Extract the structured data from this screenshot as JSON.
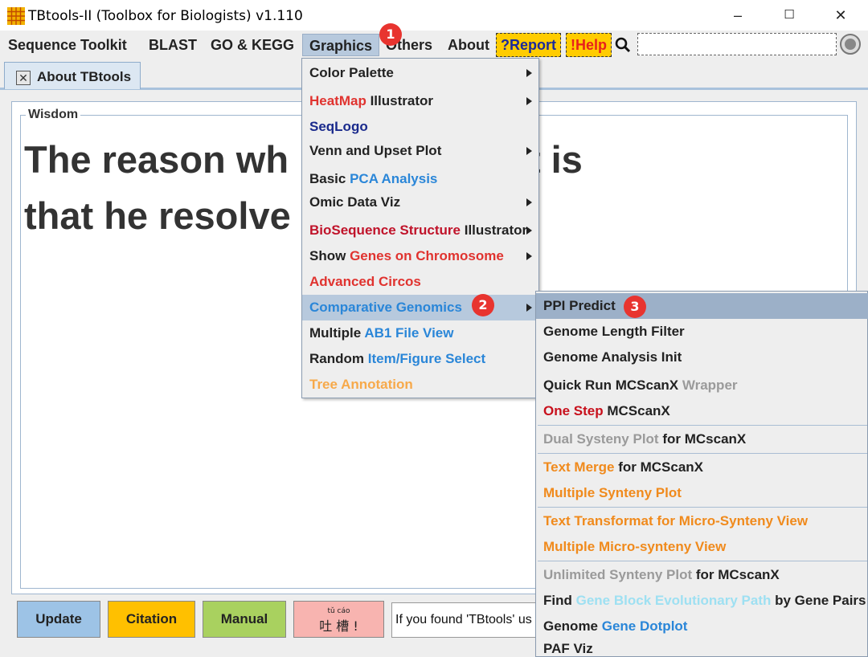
{
  "window": {
    "title": "TBtools-II (Toolbox for Biologists) v1.110",
    "minimize_label": "–",
    "maximize_label": "☐",
    "close_label": "✕"
  },
  "menubar": {
    "items": [
      "Sequence Toolkit",
      "BLAST",
      "GO & KEGG",
      "Graphics",
      "Others",
      "About"
    ],
    "report_label": "?Report",
    "help_label": "!Help",
    "search_placeholder": ""
  },
  "tab": {
    "label": "About TBtools",
    "close": "✕"
  },
  "wisdom": {
    "legend": "Wisdom",
    "line1": "The reason wh      an is great is",
    "line2": "that he resolve        at man."
  },
  "bottom": {
    "update": "Update",
    "citation": "Citation",
    "manual": "Manual",
    "tucao_pinyin": "tǔ   cáo",
    "tucao": "吐 槽 !",
    "notice": "If you found 'TBtools' us"
  },
  "graphics_menu": {
    "color_palette": "Color Palette",
    "heatmap_a": "HeatMap",
    "heatmap_b": " Illustrator",
    "seqlogo": "SeqLogo",
    "venn": "Venn and Upset Plot",
    "pca_a": "Basic ",
    "pca_b": "PCA Analysis",
    "omic": "Omic Data Viz",
    "bioseq_a": "BioSequence Structure",
    "bioseq_b": " Illustrator",
    "show_a": "Show ",
    "show_b": "Genes on Chromosome",
    "circos": "Advanced Circos",
    "comparative": "Comparative Genomics",
    "ab1_a": "Multiple ",
    "ab1_b": "AB1 File View",
    "random_a": "Random ",
    "random_b": "Item/Figure Select",
    "tree": "Tree Annotation"
  },
  "comparative_submenu": {
    "ppi": "PPI Predict",
    "genome_length": "Genome Length Filter",
    "genome_analysis": "Genome Analysis Init",
    "quick_a": "Quick Run MCScanX",
    "quick_b": " Wrapper",
    "onestep_a": "One Step",
    "onestep_b": " MCScanX",
    "dual_a": "Dual Systeny Plot",
    "dual_b": " for MCscanX",
    "textmerge_a": "Text Merge",
    "textmerge_b": " for MCScanX",
    "multi_synteny": "Multiple Synteny Plot",
    "text_transformat": "Text Transformat for Micro-Synteny View",
    "multi_micro": "Multiple Micro-synteny View",
    "unlimited_a": "Unlimited Synteny Plot",
    "unlimited_b": " for MCscanX",
    "find_a": "Find ",
    "find_b": "Gene Block Evolutionary Path",
    "find_c": " by Gene Pairs",
    "dotplot_a": "Genome ",
    "dotplot_b": "Gene Dotplot",
    "paf": "PAF Viz"
  },
  "badges": [
    "1",
    "2",
    "3"
  ],
  "colors": {
    "menu_highlight": "#b7c9dd",
    "report_bg": "#ffcc00",
    "help_bg": "#ffcc00",
    "update_btn": "#9dc3e6",
    "citation_btn": "#ffc000",
    "manual_btn": "#a9d15f",
    "tucao_btn": "#f8b4b0",
    "badge": "#e8342f"
  }
}
